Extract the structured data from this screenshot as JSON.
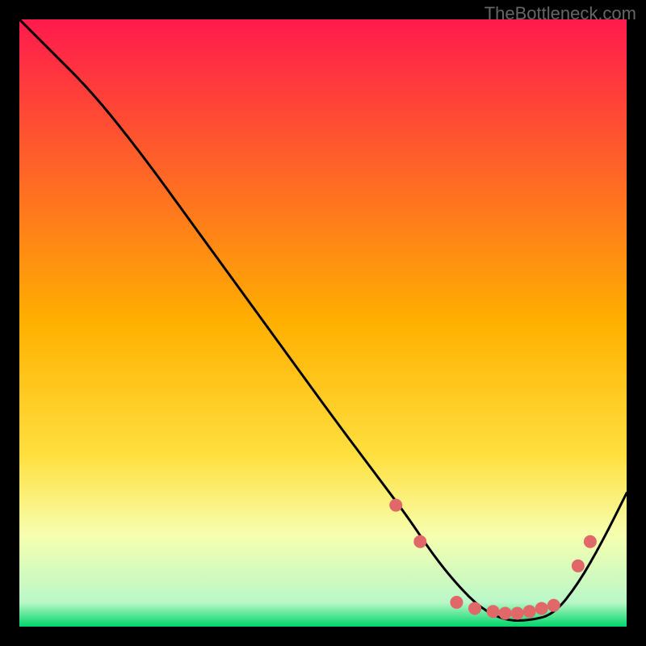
{
  "watermark": "TheBottleneck.com",
  "chart_data": {
    "type": "line",
    "title": "",
    "xlabel": "",
    "ylabel": "",
    "xlim": [
      0,
      100
    ],
    "ylim": [
      0,
      100
    ],
    "background_gradient": {
      "top_color": "#ff1a4d",
      "mid_color": "#ffd400",
      "low_color": "#f6ffb0",
      "bottom_color": "#00d66b",
      "stops": [
        {
          "offset": 0.0,
          "color": "#ff1a4d"
        },
        {
          "offset": 0.5,
          "color": "#ffb000"
        },
        {
          "offset": 0.72,
          "color": "#ffe040"
        },
        {
          "offset": 0.85,
          "color": "#f6ffb0"
        },
        {
          "offset": 0.96,
          "color": "#baf7c8"
        },
        {
          "offset": 1.0,
          "color": "#00d66b"
        }
      ]
    },
    "series": [
      {
        "name": "bottleneck-curve",
        "x": [
          0,
          5,
          12,
          20,
          28,
          36,
          44,
          52,
          58,
          64,
          68,
          72,
          76,
          80,
          84,
          88,
          92,
          96,
          100
        ],
        "y": [
          100,
          95,
          88,
          78,
          67,
          56,
          45,
          34,
          26,
          18,
          12,
          7,
          3,
          1,
          1,
          2,
          7,
          14,
          22
        ]
      }
    ],
    "markers": {
      "name": "highlight-points",
      "color": "#e06868",
      "radius": 8,
      "points": [
        {
          "x": 62,
          "y": 20
        },
        {
          "x": 66,
          "y": 14
        },
        {
          "x": 72,
          "y": 4
        },
        {
          "x": 75,
          "y": 3
        },
        {
          "x": 78,
          "y": 2.5
        },
        {
          "x": 80,
          "y": 2.2
        },
        {
          "x": 82,
          "y": 2.2
        },
        {
          "x": 84,
          "y": 2.5
        },
        {
          "x": 86,
          "y": 3
        },
        {
          "x": 88,
          "y": 3.5
        },
        {
          "x": 92,
          "y": 10
        },
        {
          "x": 94,
          "y": 14
        }
      ]
    }
  }
}
